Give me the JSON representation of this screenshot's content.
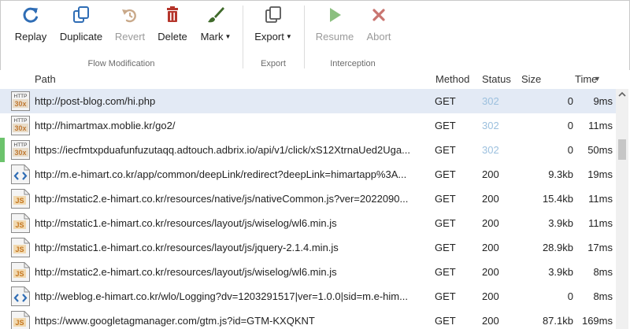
{
  "toolbar": {
    "flow_group_label": "Flow Modification",
    "export_group_label": "Export",
    "interception_group_label": "Interception",
    "buttons": {
      "replay": "Replay",
      "duplicate": "Duplicate",
      "revert": "Revert",
      "delete": "Delete",
      "mark": "Mark",
      "export": "Export",
      "resume": "Resume",
      "abort": "Abort"
    },
    "colors": {
      "replay": "#2f6db5",
      "delete": "#b5352b",
      "mark": "#3f6a2a",
      "resume": "#8bbf7f",
      "abort": "#c97570"
    }
  },
  "columns": {
    "path": "Path",
    "method": "Method",
    "status": "Status",
    "size": "Size",
    "time": "Time"
  },
  "rows": [
    {
      "icon": "http-30x-icon",
      "path": "http://post-blog.com/hi.php",
      "method": "GET",
      "status": "302",
      "size": "0",
      "time": "9ms",
      "selected": true,
      "mark": ""
    },
    {
      "icon": "http-30x-icon",
      "path": "http://himartmax.moblie.kr/go2/",
      "method": "GET",
      "status": "302",
      "size": "0",
      "time": "11ms",
      "selected": false,
      "mark": ""
    },
    {
      "icon": "http-30x-icon",
      "path": "https://iecfmtxpduafunfuzutaqq.adtouch.adbrix.io/api/v1/click/xS12XtrnaUed2Uga...",
      "method": "GET",
      "status": "302",
      "size": "0",
      "time": "50ms",
      "selected": false,
      "mark": "#6cc36c"
    },
    {
      "icon": "code-icon",
      "path": "http://m.e-himart.co.kr/app/common/deepLink/redirect?deepLink=himartapp%3A...",
      "method": "GET",
      "status": "200",
      "size": "9.3kb",
      "time": "19ms",
      "selected": false,
      "mark": ""
    },
    {
      "icon": "js-icon",
      "path": "http://mstatic2.e-himart.co.kr/resources/native/js/nativeCommon.js?ver=2022090...",
      "method": "GET",
      "status": "200",
      "size": "15.4kb",
      "time": "11ms",
      "selected": false,
      "mark": ""
    },
    {
      "icon": "js-icon",
      "path": "http://mstatic1.e-himart.co.kr/resources/layout/js/wiselog/wl6.min.js",
      "method": "GET",
      "status": "200",
      "size": "3.9kb",
      "time": "11ms",
      "selected": false,
      "mark": ""
    },
    {
      "icon": "js-icon",
      "path": "http://mstatic1.e-himart.co.kr/resources/layout/js/jquery-2.1.4.min.js",
      "method": "GET",
      "status": "200",
      "size": "28.9kb",
      "time": "17ms",
      "selected": false,
      "mark": ""
    },
    {
      "icon": "js-icon",
      "path": "http://mstatic2.e-himart.co.kr/resources/layout/js/wiselog/wl6.min.js",
      "method": "GET",
      "status": "200",
      "size": "3.9kb",
      "time": "8ms",
      "selected": false,
      "mark": ""
    },
    {
      "icon": "code-icon",
      "path": "http://weblog.e-himart.co.kr/wlo/Logging?dv=1203291517|ver=1.0.0|sid=m.e-him...",
      "method": "GET",
      "status": "200",
      "size": "0",
      "time": "8ms",
      "selected": false,
      "mark": ""
    },
    {
      "icon": "js-icon",
      "path": "https://www.googletagmanager.com/gtm.js?id=GTM-KXQKNT",
      "method": "GET",
      "status": "200",
      "size": "87.1kb",
      "time": "169ms",
      "selected": false,
      "mark": ""
    }
  ]
}
